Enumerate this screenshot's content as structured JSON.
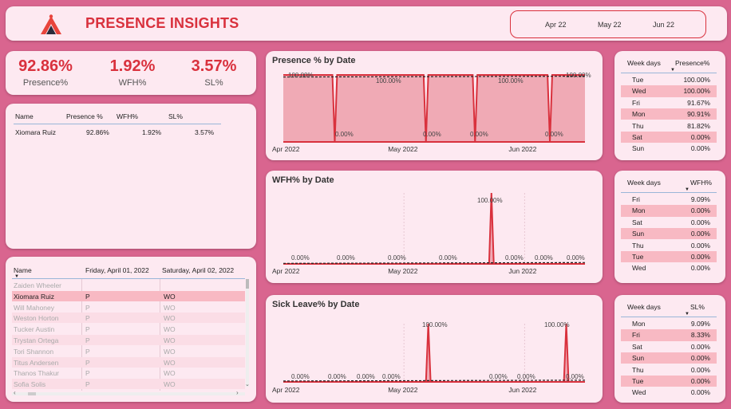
{
  "header": {
    "title": "PRESENCE INSIGHTS",
    "slicer": [
      "Apr 22",
      "May 22",
      "Jun 22"
    ]
  },
  "kpis": [
    {
      "value": "92.86%",
      "label": "Presence%"
    },
    {
      "value": "1.92%",
      "label": "WFH%"
    },
    {
      "value": "3.57%",
      "label": "SL%"
    }
  ],
  "summary_table": {
    "headers": [
      "Name",
      "Presence %",
      "WFH%",
      "SL%"
    ],
    "rows": [
      [
        "Xiomara Ruiz",
        "92.86%",
        "1.92%",
        "3.57%"
      ]
    ]
  },
  "attendance_table": {
    "headers": [
      "Name",
      "Friday, April 01, 2022",
      "Saturday, April 02, 2022"
    ],
    "rows": [
      [
        "Zaiden Wheeler",
        "",
        ""
      ],
      [
        "Xiomara Ruiz",
        "P",
        "WO"
      ],
      [
        "Will Mahoney",
        "P",
        "WO"
      ],
      [
        "Weston Horton",
        "P",
        "WO"
      ],
      [
        "Tucker Austin",
        "P",
        "WO"
      ],
      [
        "Trystan Ortega",
        "P",
        "WO"
      ],
      [
        "Tori Shannon",
        "P",
        "WO"
      ],
      [
        "Titus Andersen",
        "P",
        "WO"
      ],
      [
        "Thanos Thakur",
        "P",
        "WO"
      ],
      [
        "Sofia Solis",
        "P",
        "WO"
      ]
    ]
  },
  "chart_data": [
    {
      "type": "area",
      "title": "Presence % by Date",
      "x_ticks": [
        "Apr 2022",
        "May 2022",
        "Jun 2022"
      ],
      "ylim": [
        0,
        100
      ],
      "values": [
        100,
        100,
        100,
        100,
        100,
        100,
        100,
        100,
        100,
        100,
        100,
        100,
        100,
        100,
        100,
        100,
        100,
        100,
        100,
        100,
        100,
        100,
        0,
        100,
        100,
        100,
        100,
        100,
        100,
        100,
        100,
        100,
        100,
        100,
        100,
        100,
        100,
        100,
        100,
        100,
        100,
        100,
        100,
        100,
        100,
        100,
        100,
        100,
        100,
        100,
        100,
        100,
        100,
        100,
        100,
        100,
        100,
        100,
        100,
        100,
        100,
        0,
        100,
        100,
        100,
        100,
        100,
        100,
        100,
        100,
        100,
        100,
        100,
        100,
        100,
        100,
        100,
        100,
        100,
        100,
        100,
        100,
        0,
        100,
        100,
        100,
        100,
        100,
        100,
        100,
        100,
        100,
        100,
        100,
        100,
        100,
        100,
        100,
        100,
        100,
        100,
        100,
        100,
        100,
        100,
        100,
        100,
        100,
        100,
        100,
        100,
        100,
        100,
        100,
        0,
        100,
        100,
        100,
        100,
        100,
        100,
        100,
        100,
        100,
        100,
        100,
        100,
        100,
        100,
        100
      ],
      "data_labels": [
        "100.00%",
        "100.00%",
        "100.00%",
        "100.00%",
        "0.00%",
        "0.00%",
        "0.00%",
        "0.00%"
      ]
    },
    {
      "type": "area",
      "title": "WFH% by Date",
      "x_ticks": [
        "Apr 2022",
        "May 2022",
        "Jun 2022"
      ],
      "ylim": [
        0,
        100
      ],
      "values": [
        0,
        0,
        0,
        0,
        0,
        0,
        0,
        0,
        0,
        0,
        0,
        0,
        0,
        0,
        0,
        0,
        0,
        0,
        0,
        0,
        0,
        0,
        0,
        0,
        0,
        0,
        0,
        0,
        0,
        0,
        0,
        0,
        0,
        0,
        0,
        0,
        0,
        0,
        0,
        0,
        0,
        0,
        0,
        0,
        0,
        0,
        0,
        0,
        0,
        0,
        0,
        0,
        0,
        0,
        0,
        0,
        0,
        0,
        0,
        0,
        0,
        0,
        0,
        0,
        0,
        0,
        0,
        0,
        0,
        0,
        0,
        0,
        0,
        0,
        0,
        0,
        0,
        0,
        0,
        0,
        0,
        0,
        0,
        0,
        0,
        0,
        0,
        0,
        0,
        100,
        0,
        0,
        0,
        0,
        0,
        0,
        0,
        0,
        0,
        0,
        0,
        0,
        0,
        0,
        0,
        0,
        0,
        0,
        0,
        0,
        0,
        0,
        0,
        0,
        0,
        0,
        0,
        0,
        0,
        0,
        0,
        0,
        0,
        0,
        0,
        0,
        0,
        0,
        0,
        0
      ],
      "data_labels": [
        "0.00%",
        "0.00%",
        "0.00%",
        "0.00%",
        "100.00%",
        "0.00%",
        "0.00%",
        "0.00%"
      ]
    },
    {
      "type": "area",
      "title": "Sick Leave% by Date",
      "x_ticks": [
        "Apr 2022",
        "May 2022",
        "Jun 2022"
      ],
      "ylim": [
        0,
        100
      ],
      "values": [
        0,
        0,
        0,
        0,
        0,
        0,
        0,
        0,
        0,
        0,
        0,
        0,
        0,
        0,
        0,
        0,
        0,
        0,
        0,
        0,
        0,
        0,
        0,
        0,
        0,
        0,
        0,
        0,
        0,
        0,
        0,
        0,
        0,
        0,
        0,
        0,
        0,
        0,
        0,
        0,
        0,
        0,
        0,
        0,
        0,
        0,
        0,
        0,
        0,
        0,
        0,
        0,
        0,
        0,
        0,
        0,
        0,
        0,
        0,
        0,
        0,
        0,
        100,
        0,
        0,
        0,
        0,
        0,
        0,
        0,
        0,
        0,
        0,
        0,
        0,
        0,
        0,
        0,
        0,
        0,
        0,
        0,
        0,
        0,
        0,
        0,
        0,
        0,
        0,
        0,
        0,
        0,
        0,
        0,
        0,
        0,
        0,
        0,
        0,
        0,
        0,
        0,
        0,
        0,
        0,
        0,
        0,
        0,
        0,
        0,
        0,
        0,
        0,
        0,
        0,
        0,
        0,
        0,
        0,
        0,
        0,
        100,
        0,
        0,
        0,
        0,
        0,
        0,
        0,
        0
      ],
      "data_labels": [
        "0.00%",
        "0.00%",
        "0.00%",
        "0.00%",
        "100.00%",
        "0.00%",
        "0.00%",
        "100.00%",
        "0.00%"
      ]
    }
  ],
  "weekday_tables": [
    {
      "headers": [
        "Week days",
        "Presence%"
      ],
      "rows": [
        [
          "Tue",
          "100.00%"
        ],
        [
          "Wed",
          "100.00%"
        ],
        [
          "Fri",
          "91.67%"
        ],
        [
          "Mon",
          "90.91%"
        ],
        [
          "Thu",
          "81.82%"
        ],
        [
          "Sat",
          "0.00%"
        ],
        [
          "Sun",
          "0.00%"
        ]
      ]
    },
    {
      "headers": [
        "Week days",
        "WFH%"
      ],
      "rows": [
        [
          "Fri",
          "9.09%"
        ],
        [
          "Mon",
          "0.00%"
        ],
        [
          "Sat",
          "0.00%"
        ],
        [
          "Sun",
          "0.00%"
        ],
        [
          "Thu",
          "0.00%"
        ],
        [
          "Tue",
          "0.00%"
        ],
        [
          "Wed",
          "0.00%"
        ]
      ]
    },
    {
      "headers": [
        "Week days",
        "SL%"
      ],
      "rows": [
        [
          "Mon",
          "9.09%"
        ],
        [
          "Fri",
          "8.33%"
        ],
        [
          "Sat",
          "0.00%"
        ],
        [
          "Sun",
          "0.00%"
        ],
        [
          "Thu",
          "0.00%"
        ],
        [
          "Tue",
          "0.00%"
        ],
        [
          "Wed",
          "0.00%"
        ]
      ]
    }
  ],
  "colors": {
    "accent": "#d9313d",
    "background": "#d9658f",
    "card": "#fde9f1",
    "area_fill": "#f0aab5",
    "row_highlight": "#f8b9c3"
  }
}
